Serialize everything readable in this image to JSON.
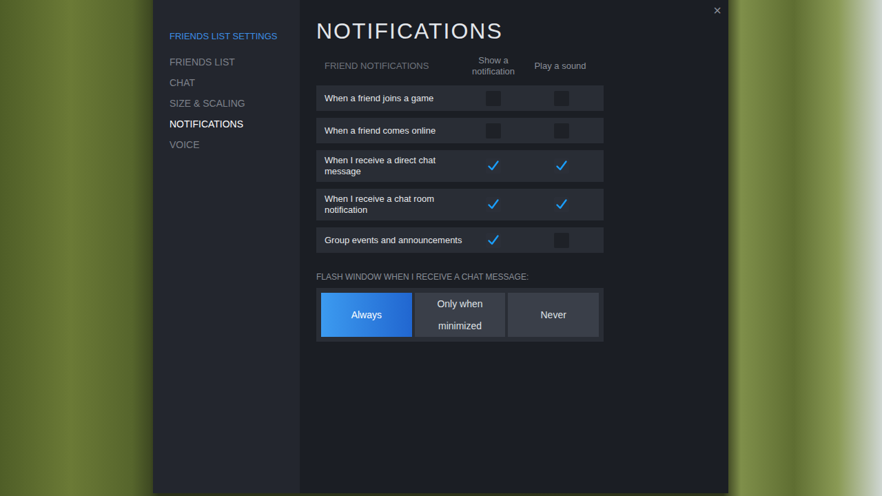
{
  "window": {
    "close": "×"
  },
  "sidebar": {
    "title": "FRIENDS LIST SETTINGS",
    "items": [
      {
        "label": "FRIENDS LIST",
        "selected": false
      },
      {
        "label": "CHAT",
        "selected": false
      },
      {
        "label": "SIZE & SCALING",
        "selected": false
      },
      {
        "label": "NOTIFICATIONS",
        "selected": true
      },
      {
        "label": "VOICE",
        "selected": false
      }
    ]
  },
  "heading": "NOTIFICATIONS",
  "table": {
    "title": "FRIEND NOTIFICATIONS",
    "columns": [
      "Show a notification",
      "Play a sound"
    ],
    "rows": [
      {
        "label": "When a friend joins a game",
        "notification": false,
        "sound": false
      },
      {
        "label": "When a friend comes online",
        "notification": false,
        "sound": false
      },
      {
        "label": "When I receive a direct chat message",
        "notification": true,
        "sound": true
      },
      {
        "label": "When I receive a chat room notification",
        "notification": true,
        "sound": true
      },
      {
        "label": "Group events and announcements",
        "notification": true,
        "sound": false
      }
    ]
  },
  "flash": {
    "label": "FLASH WINDOW WHEN I RECEIVE A CHAT MESSAGE:",
    "options": [
      {
        "label": "Always",
        "selected": true
      },
      {
        "label": "Only when minimized",
        "selected": false
      },
      {
        "label": "Never",
        "selected": false
      }
    ]
  }
}
